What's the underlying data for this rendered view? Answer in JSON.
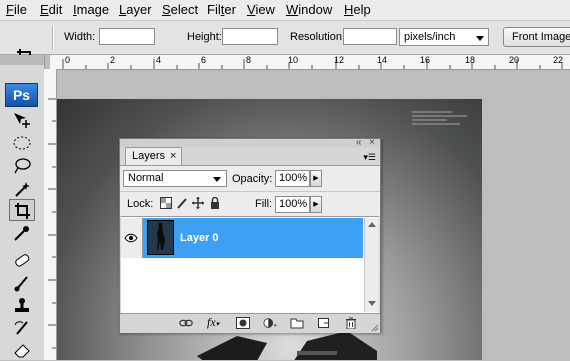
{
  "menu": [
    {
      "label": "File",
      "accel": "F"
    },
    {
      "label": "Edit",
      "accel": "E"
    },
    {
      "label": "Image",
      "accel": "I"
    },
    {
      "label": "Layer",
      "accel": "L"
    },
    {
      "label": "Select",
      "accel": "S"
    },
    {
      "label": "Filter",
      "accel": "t"
    },
    {
      "label": "View",
      "accel": "V"
    },
    {
      "label": "Window",
      "accel": "W"
    },
    {
      "label": "Help",
      "accel": "H"
    }
  ],
  "options": {
    "width_label": "Width:",
    "width_value": "",
    "height_label": "Height:",
    "height_value": "",
    "resolution_label": "Resolution:",
    "resolution_value": "",
    "units": "pixels/inch",
    "front_image": "Front Image"
  },
  "ruler": {
    "labels": [
      "0",
      "2",
      "4",
      "6",
      "8",
      "10",
      "12",
      "14",
      "16",
      "18",
      "20",
      "22"
    ]
  },
  "toolbox": {
    "logo": "Ps"
  },
  "layers_panel": {
    "tab": "Layers",
    "tab_close": "×",
    "collapse": "«",
    "close": "×",
    "blend_mode": "Normal",
    "opacity_label": "Opacity:",
    "opacity": "100%",
    "lock_label": "Lock:",
    "fill_label": "Fill:",
    "fill": "100%",
    "layer_name": "Layer 0"
  },
  "colors": {
    "selection": "#3ea0f5",
    "ps_logo": "#1f65c2"
  }
}
